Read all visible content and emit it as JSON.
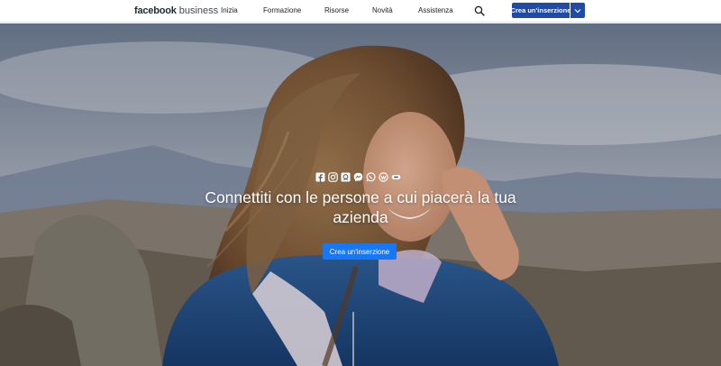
{
  "header": {
    "brand": {
      "fb": "facebook",
      "biz": "business"
    },
    "nav": [
      {
        "label": "Inizia"
      },
      {
        "label": "Formazione"
      },
      {
        "label": "Risorse"
      },
      {
        "label": "Novità"
      },
      {
        "label": "Assistenza"
      }
    ],
    "search_icon": "search-icon",
    "cta_label": "Crea un'inserzione",
    "cta_dropdown_icon": "chevron-down-icon"
  },
  "hero": {
    "platform_icons": [
      "facebook-icon",
      "instagram-icon",
      "messenger-box-icon",
      "messenger-icon",
      "whatsapp-icon",
      "workplace-icon",
      "audience-network-icon"
    ],
    "headline": "Connettiti con le persone a cui piacerà la tua azienda",
    "cta_label": "Crea un'inserzione"
  },
  "colors": {
    "header_cta_bg": "#1f4aa5",
    "hero_cta_bg": "#1877f2",
    "brand_text": "#1c2b33"
  }
}
